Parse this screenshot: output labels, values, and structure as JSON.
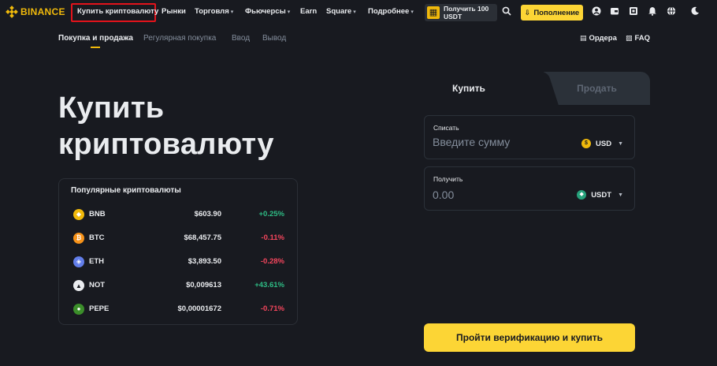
{
  "header": {
    "logo_text": "BINANCE",
    "nav": [
      {
        "label": "Купить криптовалюту",
        "caret": false
      },
      {
        "label": "Рынки",
        "caret": false
      },
      {
        "label": "Торговля",
        "caret": true
      },
      {
        "label": "Фьючерсы",
        "caret": true
      },
      {
        "label": "Earn",
        "caret": false
      },
      {
        "label": "Square",
        "caret": true
      },
      {
        "label": "Подробнее",
        "caret": true
      }
    ],
    "promo_text": "Получить 100 USDT",
    "deposit_label": "Пополнение"
  },
  "subnav": {
    "tabs": [
      "Покупка и продажа",
      "Регулярная покупка",
      "Ввод",
      "Вывод"
    ],
    "active_tab": 0,
    "orders_label": "Ордера",
    "faq_label": "FAQ"
  },
  "hero": {
    "title_line1": "Купить",
    "title_line2": "криптовалюту"
  },
  "popular": {
    "title": "Популярные криптовалюты",
    "coins": [
      {
        "symbol": "BNB",
        "price": "$603.90",
        "change": "+0.25%",
        "direction": "up",
        "color": "#f0b90b"
      },
      {
        "symbol": "BTC",
        "price": "$68,457.75",
        "change": "-0.11%",
        "direction": "down",
        "color": "#f7931a"
      },
      {
        "symbol": "ETH",
        "price": "$3,893.50",
        "change": "-0.28%",
        "direction": "down",
        "color": "#627eea"
      },
      {
        "symbol": "NOT",
        "price": "$0,009613",
        "change": "+43.61%",
        "direction": "up",
        "color": "#1e2329"
      },
      {
        "symbol": "PEPE",
        "price": "$0,00001672",
        "change": "-0.71%",
        "direction": "down",
        "color": "#3b8e2a"
      }
    ]
  },
  "trade": {
    "buy_tab": "Купить",
    "sell_tab": "Продать",
    "spend_label": "Списать",
    "spend_placeholder": "Введите сумму",
    "spend_currency": "USD",
    "receive_label": "Получить",
    "receive_value": "0.00",
    "receive_currency": "USDT",
    "verify_button": "Пройти верификацию и купить"
  },
  "colors": {
    "accent": "#fcd535",
    "positive": "#2ebd85",
    "negative": "#f6465d",
    "background": "#181a20"
  }
}
